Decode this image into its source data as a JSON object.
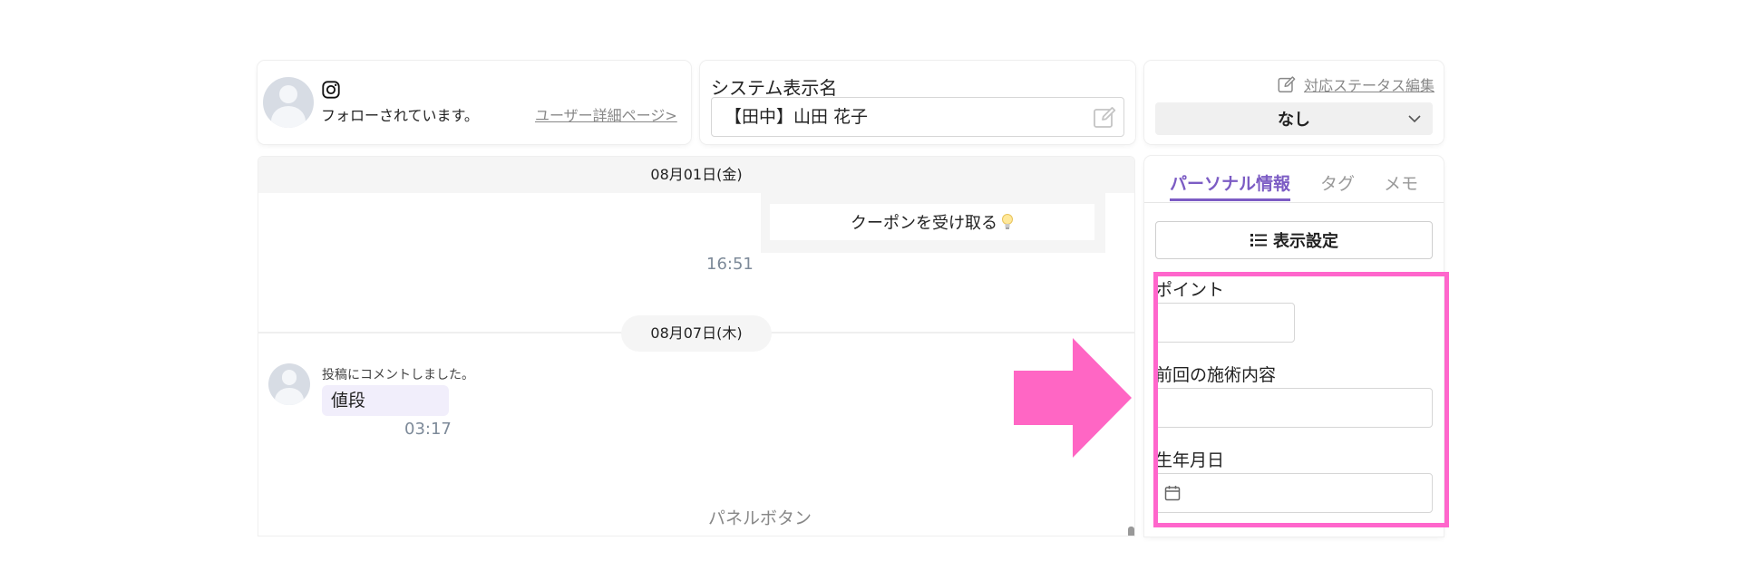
{
  "user_card": {
    "follow_status": "フォローされています。",
    "detail_link": "ユーザー詳細ページ>"
  },
  "system_name": {
    "label": "システム表示名",
    "value": "【田中】山田 花子"
  },
  "status": {
    "edit_label": "対応ステータス編集",
    "selected": "なし"
  },
  "chat": {
    "date_1": "08月01日(金)",
    "coupon_message": "クーポンを受け取る",
    "time_1": "16:51",
    "date_2": "08月07日(木)",
    "comment_action": "投稿にコメントしました。",
    "comment_text": "値段",
    "time_2": "03:17",
    "panel_button": "パネルボタン"
  },
  "side_panel": {
    "tabs": [
      {
        "label": "パーソナル情報",
        "active": true
      },
      {
        "label": "タグ",
        "active": false
      },
      {
        "label": "メモ",
        "active": false
      }
    ],
    "display_settings": "表示設定",
    "fields": {
      "points_label": "ポイント",
      "points_value": "",
      "previous_treatment_label": "前回の施術内容",
      "previous_treatment_value": "",
      "birthdate_label": "生年月日",
      "birthdate_value": ""
    }
  },
  "icons": {
    "social": "instagram-icon",
    "edit": "pencil-edit-icon",
    "bulb": "light-bulb-icon",
    "list": "list-icon",
    "calendar": "calendar-icon",
    "chevron": "chevron-down-icon"
  },
  "colors": {
    "accent_purple": "#7c5cc4",
    "highlight_pink": "#ff66cc",
    "comment_bubble": "#f1eefb",
    "time_text": "#7d8a99"
  }
}
